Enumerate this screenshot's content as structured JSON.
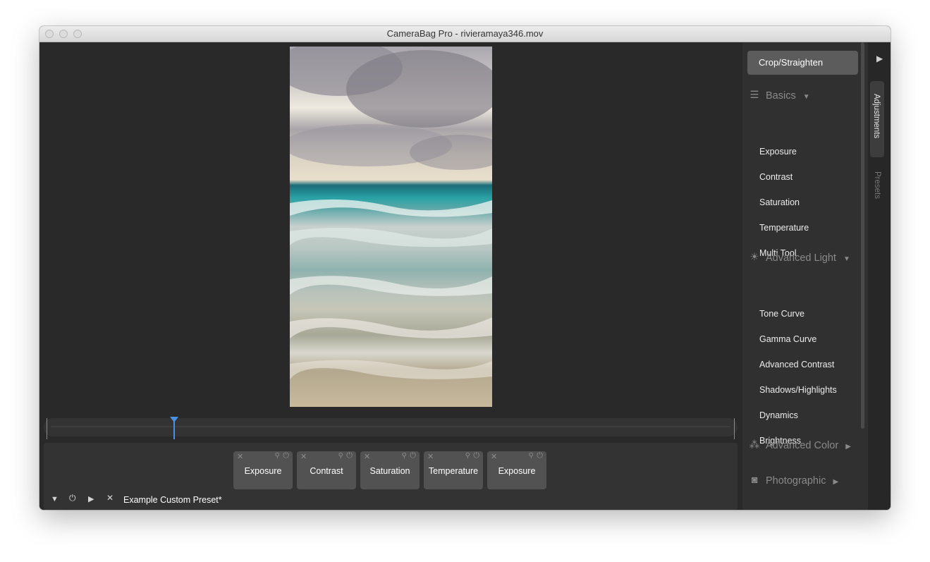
{
  "window": {
    "title": "CameraBag Pro - rivieramaya346.mov"
  },
  "layers": [
    {
      "label": "Exposure"
    },
    {
      "label": "Contrast"
    },
    {
      "label": "Saturation"
    },
    {
      "label": "Temperature"
    },
    {
      "label": "Exposure"
    }
  ],
  "layer_controls": {
    "close": "✕",
    "pin": "📌",
    "power": "⏻"
  },
  "stack_controls": {
    "collapse": "▼",
    "power": "⏻",
    "play": "▶",
    "close": "✕"
  },
  "preset": {
    "name": "Example Custom Preset*"
  },
  "timeline": {
    "playhead_position": 0.18
  },
  "panel": {
    "crop_button": "Crop/Straighten",
    "sections": [
      {
        "title": "Basics",
        "arrow": "▼",
        "icon": "sliders-icon",
        "items": [
          "Exposure",
          "Contrast",
          "Saturation",
          "Temperature",
          "Multi Tool"
        ]
      },
      {
        "title": "Advanced Light",
        "arrow": "▼",
        "icon": "sun-icon",
        "items": [
          "Tone Curve",
          "Gamma Curve",
          "Advanced Contrast",
          "Shadows/Highlights",
          "Dynamics",
          "Brightness"
        ]
      },
      {
        "title": "Advanced Color",
        "arrow": "▶",
        "icon": "color-circles-icon",
        "items": []
      },
      {
        "title": "Photographic",
        "arrow": "▶",
        "icon": "camera-icon",
        "items": []
      }
    ]
  },
  "side_tabs": {
    "adjustments": "Adjustments",
    "presets": "Presets",
    "collapse": "▶"
  }
}
